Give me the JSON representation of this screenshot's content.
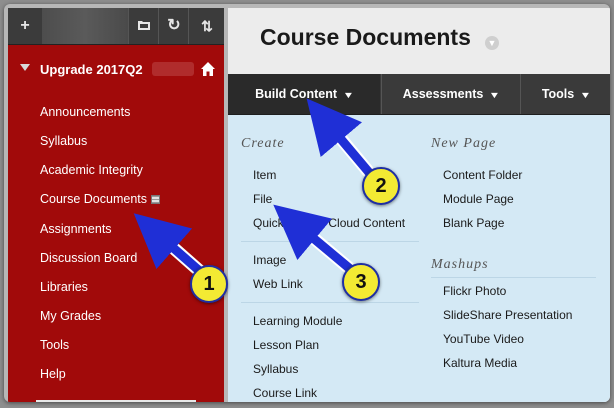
{
  "sidebar": {
    "toolbar": {
      "add_glyph": "+",
      "folder_glyph": "▤",
      "refresh_glyph": "↻",
      "sort_glyph": "⇅"
    },
    "course_title": "Upgrade 2017Q2",
    "items": [
      {
        "label": "Announcements"
      },
      {
        "label": "Syllabus"
      },
      {
        "label": "Academic Integrity"
      },
      {
        "label": "Course Documents"
      },
      {
        "label": "Assignments"
      },
      {
        "label": "Discussion Board"
      },
      {
        "label": "Libraries"
      },
      {
        "label": "My Grades"
      },
      {
        "label": "Tools"
      },
      {
        "label": "Help"
      }
    ]
  },
  "main": {
    "title": "Course Documents",
    "tabs": [
      {
        "label": "Build Content"
      },
      {
        "label": "Assessments"
      },
      {
        "label": "Tools"
      }
    ],
    "dropdown": {
      "create": {
        "heading": "Create",
        "items": [
          "Item",
          "File",
          "Quick Upload Cloud Content",
          "Image",
          "Web Link",
          "Learning Module",
          "Lesson Plan",
          "Syllabus",
          "Course Link"
        ]
      },
      "new_page": {
        "heading": "New Page",
        "items": [
          "Content Folder",
          "Module Page",
          "Blank Page"
        ]
      },
      "mashups": {
        "heading": "Mashups",
        "items": [
          "Flickr Photo",
          "SlideShare Presentation",
          "YouTube Video",
          "Kaltura Media"
        ]
      }
    }
  },
  "callouts": [
    {
      "number": "1"
    },
    {
      "number": "2"
    },
    {
      "number": "3"
    }
  ],
  "colors": {
    "sidebar_bg": "#a10a0a",
    "toolbar_bg": "#3b3b3b",
    "action_bar_bg": "#3a3a3a",
    "dropdown_bg": "#d4e9f5",
    "callout_fill": "#f3ea33",
    "arrow_color": "#1f2fd6"
  },
  "icons": {
    "home": "home-icon",
    "folder": "folder-icon",
    "refresh": "refresh-icon",
    "sort": "sort-icon",
    "course_documents_menu": "content-menu-icon"
  }
}
